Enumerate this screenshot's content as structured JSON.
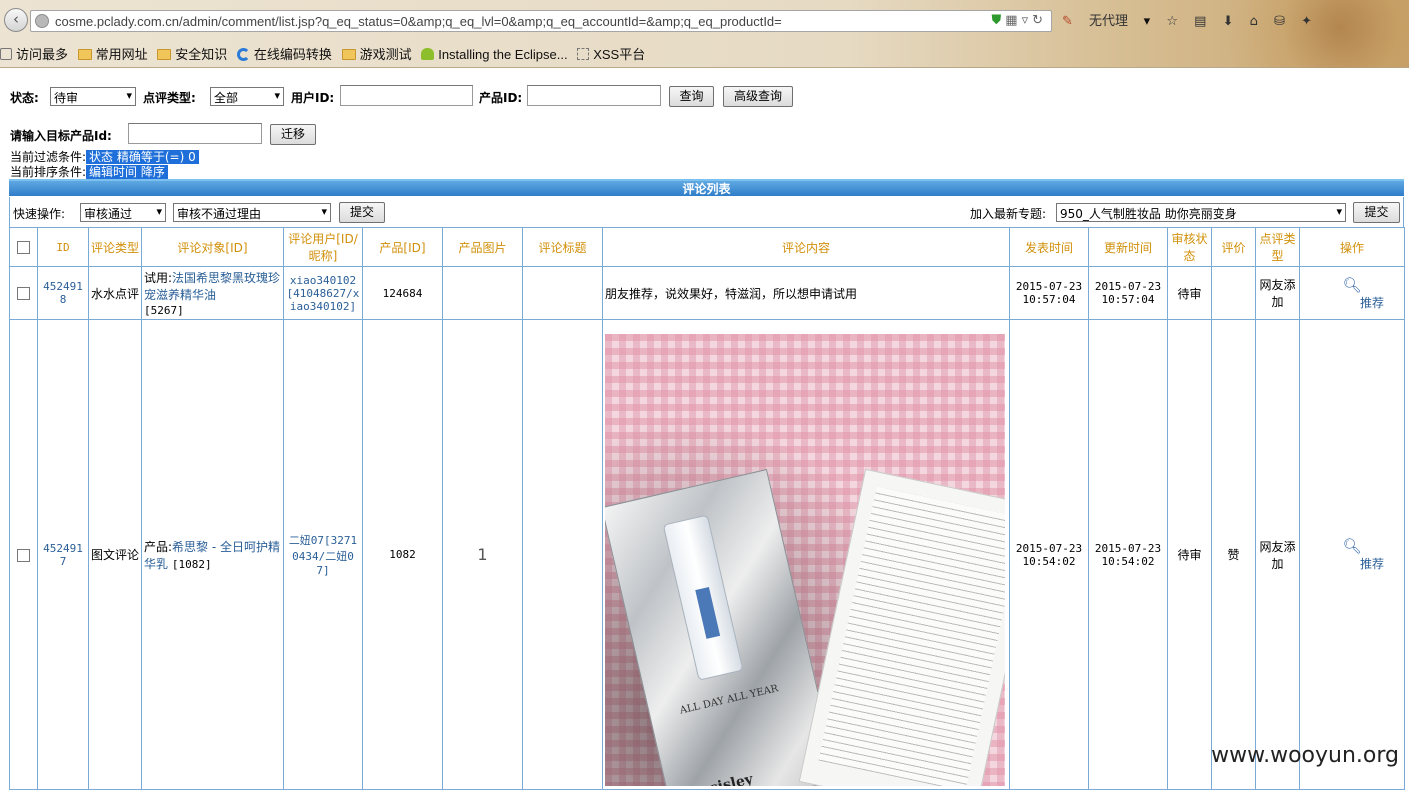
{
  "browser": {
    "url": "cosme.pclady.com.cn/admin/comment/list.jsp?q_eq_status=0&amp;q_eq_lvl=0&amp;q_eq_accountId=&amp;q_eq_productId=",
    "proxy_label": "无代理",
    "bookmarks": [
      "访问最多",
      "常用网址",
      "安全知识",
      "在线编码转换",
      "游戏测试",
      "Installing the Eclipse...",
      "XSS平台"
    ]
  },
  "filters": {
    "status_label": "状态:",
    "status_value": "待审",
    "review_type_label": "点评类型:",
    "review_type_value": "全部",
    "user_id_label": "用户ID:",
    "product_id_label": "产品ID:",
    "search_button": "查询",
    "advanced_button": "高级查询",
    "target_label": "请输入目标产品Id:",
    "migrate_button": "迁移",
    "current_filter_label": "当前过滤条件:",
    "current_filter_value": "状态 精确等于(=) 0",
    "current_sort_label": "当前排序条件:",
    "current_sort_value": "编辑时间 降序"
  },
  "list": {
    "title": "评论列表",
    "quick_op_label": "快速操作:",
    "quick_op_value": "审核通过",
    "reject_reason_value": "审核不通过理由",
    "submit_button": "提交",
    "topic_label": "加入最新专题:",
    "topic_value": "950_人气制胜妆品 助你亮丽变身",
    "submit_button_2": "提交",
    "columns": [
      "ID",
      "评论类型",
      "评论对象[ID]",
      "评论用户[ID/昵称]",
      "产品[ID]",
      "产品图片",
      "评论标题",
      "评论内容",
      "发表时间",
      "更新时间",
      "审核状态",
      "评价",
      "点评类型",
      "操作"
    ],
    "rows": [
      {
        "id": "4524918",
        "type": "水水点评",
        "target_prefix": "试用:",
        "target_link": "法国希思黎黑玫瑰珍宠滋养精华油",
        "target_id": "[5267]",
        "user": "xiao340102[41048627/xiao340102]",
        "product_id": "124684",
        "image": "",
        "title": "",
        "content": "朋友推荐，说效果好，特滋润，所以想申请试用",
        "published": "2015-07-23 10:57:04",
        "updated": "2015-07-23 10:57:04",
        "status": "待审",
        "rating": "",
        "review_type": "网友添加",
        "action": "推荐"
      },
      {
        "id": "4524917",
        "type": "图文评论",
        "target_prefix": "产品:",
        "target_link": "希思黎 - 全日呵护精华乳",
        "target_id": "[1082]",
        "user": "二妞07[32710434/二妞07]",
        "product_id": "1082",
        "image": "1",
        "title": "",
        "content": "",
        "published": "2015-07-23 10:54:02",
        "updated": "2015-07-23 10:54:02",
        "status": "待审",
        "rating": "赞",
        "review_type": "网友添加",
        "action": "推荐"
      }
    ]
  },
  "photo": {
    "pack_text": "ALL DAY ALL YEAR",
    "brand": "sisley"
  },
  "watermark": "www.wooyun.org"
}
